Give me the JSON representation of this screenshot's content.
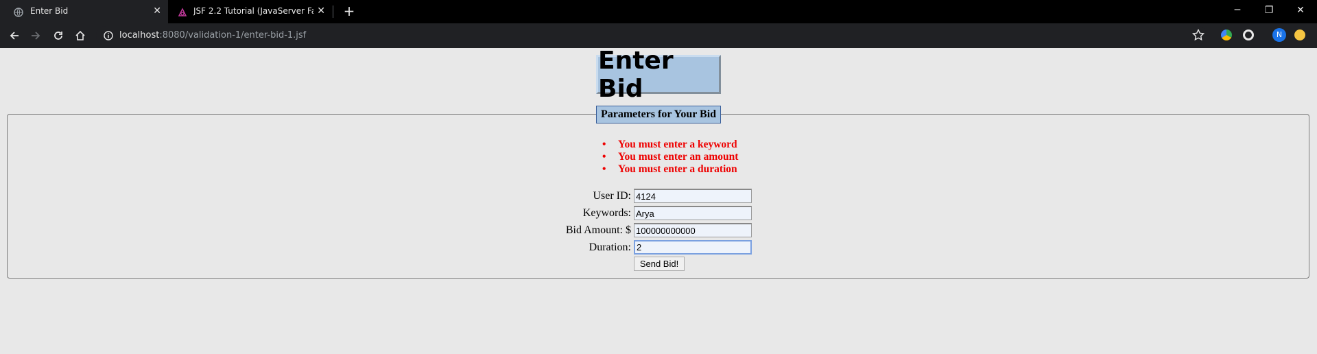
{
  "browser": {
    "tabs": [
      {
        "title": "Enter Bid",
        "active": true
      },
      {
        "title": "JSF 2.2 Tutorial (JavaServer Faces",
        "active": false
      }
    ],
    "url": {
      "host": "localhost",
      "rest": ":8080/validation-1/enter-bid-1.jsf"
    },
    "profile_initial": "N"
  },
  "page": {
    "heading": "Enter Bid",
    "legend": "Parameters for Your Bid",
    "errors": [
      "You must enter a keyword",
      "You must enter an amount",
      "You must enter a duration"
    ],
    "fields": [
      {
        "label": "User ID:",
        "value": "4124"
      },
      {
        "label": "Keywords:",
        "value": "Arya"
      },
      {
        "label": "Bid Amount: $",
        "value": "100000000000"
      },
      {
        "label": "Duration:",
        "value": "2"
      }
    ],
    "submit_label": "Send Bid!"
  },
  "colors": {
    "title_bg": "#a8c4e0",
    "error_text": "#ee0000",
    "page_bg": "#e8e8e8"
  }
}
